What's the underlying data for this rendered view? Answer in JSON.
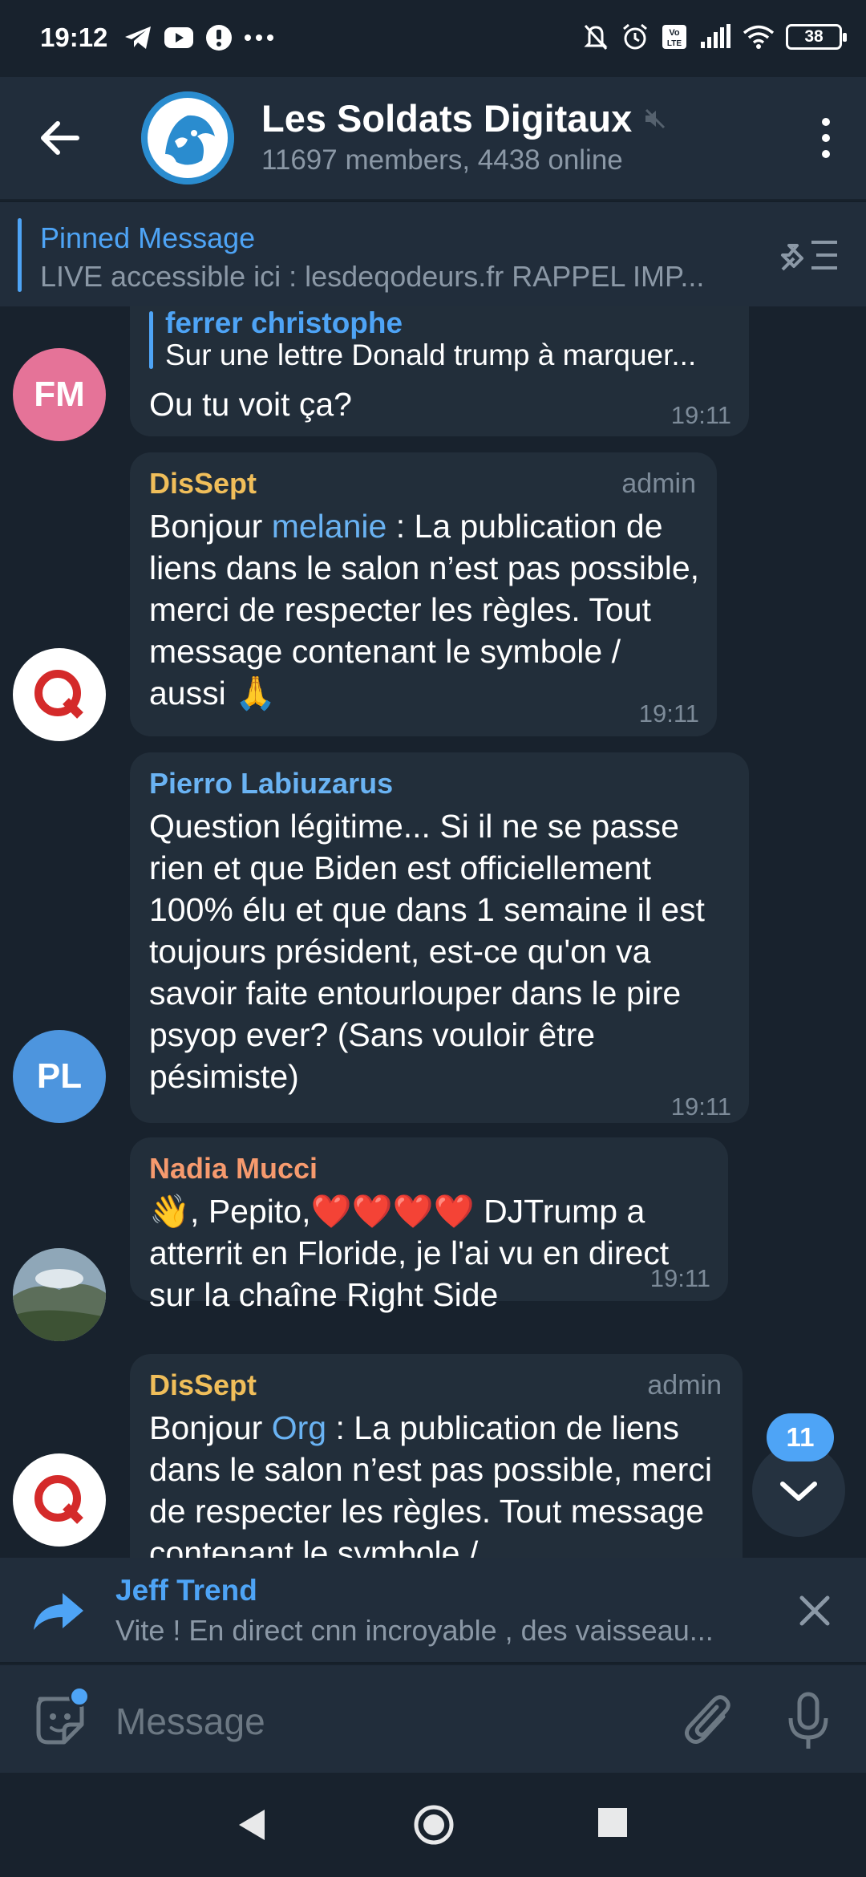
{
  "status_bar": {
    "time": "19:12",
    "battery": "38"
  },
  "header": {
    "title": "Les Soldats Digitaux",
    "subtitle": "11697 members, 4438 online"
  },
  "pinned": {
    "title": "Pinned Message",
    "text": "LIVE accessible ici : lesdeqodeurs.fr   RAPPEL IMP..."
  },
  "messages": [
    {
      "avatar_initials": "FM",
      "avatar_color": "#e57398",
      "reply_author": "ferrer christophe",
      "reply_text": "Sur une lettre Donald trump à marquer...",
      "text": "Ou tu voit ça?",
      "time": "19:11"
    },
    {
      "author": "DisSept",
      "author_color": "#f0be5a",
      "badge": "admin",
      "text_before": "Bonjour ",
      "mention": "melanie",
      "text_after": " : La publication de liens dans le salon n’est pas possible, merci de respecter les règles. Tout message contenant le symbole / aussi 🙏",
      "time": "19:11"
    },
    {
      "author": "Pierro Labiuzarus",
      "author_color": "#6ab3f3",
      "avatar_initials": "PL",
      "avatar_color": "#4d95de",
      "text": "Question légitime...  Si il ne se passe rien et que Biden est officiellement 100% élu et que dans 1 semaine il est toujours président, est-ce qu'on va savoir faite entourlouper dans le pire psyop ever? (Sans vouloir être pésimiste)",
      "time": "19:11"
    },
    {
      "author": "Nadia Mucci",
      "author_color": "#f69a6e",
      "text": "👋, Pepito,❤️❤️❤️❤️ DJTrump a atterrit en Floride, je l'ai vu en direct sur la chaîne Right Side",
      "time": "19:11"
    },
    {
      "author": "DisSept",
      "author_color": "#f0be5a",
      "badge": "admin",
      "text_before": "Bonjour ",
      "mention": "Org",
      "text_after": " : La publication de liens dans le salon n’est pas possible, merci de respecter les règles. Tout message contenant le symbole /"
    }
  ],
  "scroll": {
    "unread_count": "11"
  },
  "forward": {
    "name": "Jeff Trend",
    "text": "Vite ! En direct cnn incroyable , des vaisseau..."
  },
  "input": {
    "placeholder": "Message"
  }
}
